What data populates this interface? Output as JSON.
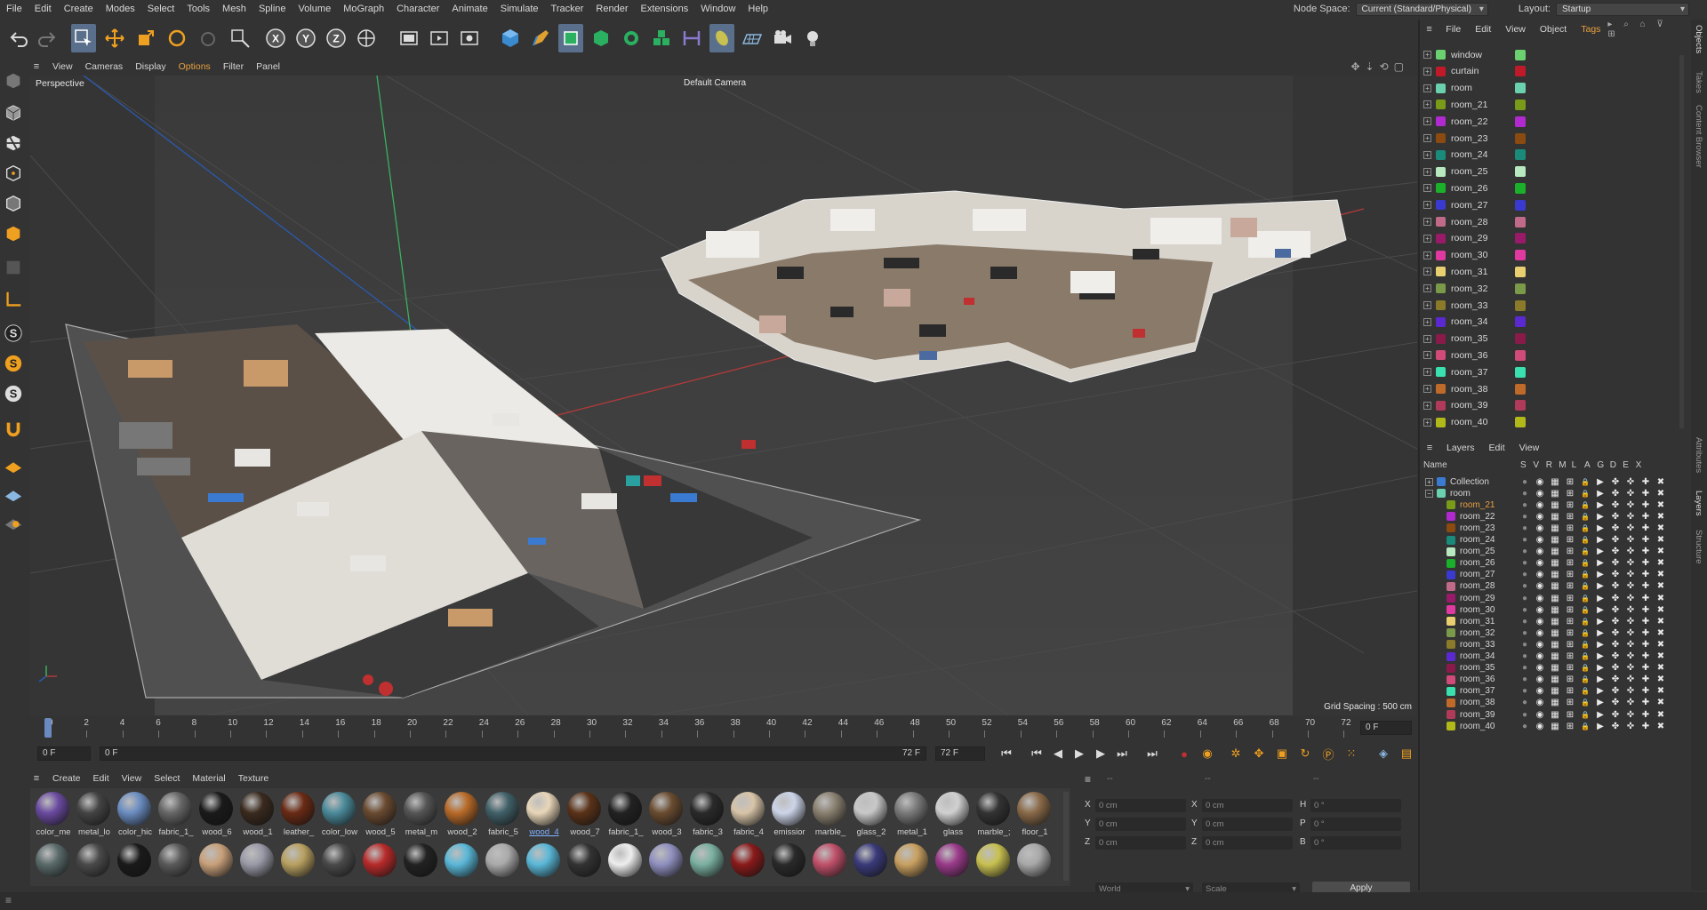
{
  "menu": {
    "items": [
      "File",
      "Edit",
      "Create",
      "Modes",
      "Select",
      "Tools",
      "Mesh",
      "Spline",
      "Volume",
      "MoGraph",
      "Character",
      "Animate",
      "Simulate",
      "Tracker",
      "Render",
      "Extensions",
      "Window",
      "Help"
    ],
    "node_space_label": "Node Space:",
    "node_space_value": "Current (Standard/Physical)",
    "layout_label": "Layout:",
    "layout_value": "Startup"
  },
  "viewport": {
    "menu": [
      "View",
      "Cameras",
      "Display",
      "Options",
      "Filter",
      "Panel"
    ],
    "view_name": "Perspective",
    "camera": "Default Camera",
    "grid_spacing": "Grid Spacing : 500 cm"
  },
  "timeline": {
    "ticks": [
      "0",
      "2",
      "4",
      "6",
      "8",
      "10",
      "12",
      "14",
      "16",
      "18",
      "20",
      "22",
      "24",
      "26",
      "28",
      "30",
      "32",
      "34",
      "36",
      "38",
      "40",
      "42",
      "44",
      "46",
      "48",
      "50",
      "52",
      "54",
      "56",
      "58",
      "60",
      "62",
      "64",
      "66",
      "68",
      "70",
      "72"
    ],
    "current_frame_right": "0 F",
    "start": "0 F",
    "preview_start": "0 F",
    "preview_end": "72 F",
    "end": "72 F"
  },
  "materials": {
    "menu": [
      "Create",
      "Edit",
      "View",
      "Select",
      "Material",
      "Texture"
    ],
    "row1": [
      "color_me",
      "metal_lo",
      "color_hic",
      "fabric_1_",
      "wood_6",
      "wood_1",
      "leather_",
      "color_low",
      "wood_5",
      "metal_m",
      "wood_2",
      "fabric_5",
      "wood_4",
      "wood_7",
      "fabric_1_",
      "wood_3",
      "fabric_3",
      "fabric_4",
      "emissior",
      "marble_",
      "glass_2",
      "metal_1",
      "glass",
      "marble_;",
      "floor_1"
    ],
    "selected": "wood_4",
    "colors_row1": [
      "#6a4aa0",
      "#444",
      "#6a8cc0",
      "#666",
      "#1a1a1a",
      "#3a2a1e",
      "#6a2a14",
      "#4a8a9a",
      "#6a4a30",
      "#555",
      "#b86a28",
      "#406068",
      "#e8d6b8",
      "#5a3218",
      "#222",
      "#6a4c30",
      "#2a2a2a",
      "#d8c4a8",
      "#ccd4e8",
      "#8a8070",
      "#c8c8c8",
      "#7a7a7a",
      "#d0d0d0",
      "#333",
      "#8a6a48"
    ],
    "colors_row2": [
      "#5a6a6a",
      "#4a4a4a",
      "#1a1a1a",
      "#5a5a5a",
      "#c8a07a",
      "#9a9aa8",
      "#b8a060",
      "#4a4a4a",
      "#b82a2a",
      "#222",
      "#5ab8d8",
      "#aaa",
      "#5ab8d8",
      "#333",
      "#eee",
      "#9090c0",
      "#7ab0a0",
      "#8a1a1a",
      "#2a2a2a",
      "#c0506a",
      "#3a3a7a",
      "#c8a060",
      "#9a3a8a",
      "#c8c050",
      "#a8a8a8"
    ]
  },
  "coords": {
    "col1_header": "--",
    "col2_header": "--",
    "col3_header": "--",
    "labels_pos": [
      "X",
      "Y",
      "Z"
    ],
    "labels_size": [
      "X",
      "Y",
      "Z"
    ],
    "labels_rot": [
      "H",
      "P",
      "B"
    ],
    "pos_values": [
      "0 cm",
      "0 cm",
      "0 cm"
    ],
    "size_values": [
      "0 cm",
      "0 cm",
      "0 cm"
    ],
    "rot_values": [
      "0 °",
      "0 °",
      "0 °"
    ],
    "mode1": "World",
    "mode2": "Scale",
    "apply": "Apply"
  },
  "objects": {
    "menu": [
      "File",
      "Edit",
      "View",
      "Object",
      "Tags"
    ],
    "rows": [
      {
        "name": "window",
        "icon": "#6ad070",
        "color": "#6ad070"
      },
      {
        "name": "curtain",
        "icon": "#c01a2a",
        "color": "#c01a2a"
      },
      {
        "name": "room",
        "icon": "#6ad0b0",
        "color": "#6ad0b0"
      },
      {
        "name": "room_21",
        "icon": "#7a9a1a",
        "color": "#7a9a1a"
      },
      {
        "name": "room_22",
        "icon": "#b02ad0",
        "color": "#b02ad0"
      },
      {
        "name": "room_23",
        "icon": "#8a4a10",
        "color": "#8a4a10"
      },
      {
        "name": "room_24",
        "icon": "#1a8a7a",
        "color": "#1a8a7a"
      },
      {
        "name": "room_25",
        "icon": "#b8e8c0",
        "color": "#b8e8c0"
      },
      {
        "name": "room_26",
        "icon": "#1ab02a",
        "color": "#1ab02a"
      },
      {
        "name": "room_27",
        "icon": "#3a3ad0",
        "color": "#3a3ad0"
      },
      {
        "name": "room_28",
        "icon": "#c06a8a",
        "color": "#c06a8a"
      },
      {
        "name": "room_29",
        "icon": "#9a1a6a",
        "color": "#9a1a6a"
      },
      {
        "name": "room_30",
        "icon": "#e03aa0",
        "color": "#e03aa0"
      },
      {
        "name": "room_31",
        "icon": "#e8d070",
        "color": "#e8d070"
      },
      {
        "name": "room_32",
        "icon": "#7a9a4a",
        "color": "#7a9a4a"
      },
      {
        "name": "room_33",
        "icon": "#8a7a2a",
        "color": "#8a7a2a"
      },
      {
        "name": "room_34",
        "icon": "#5a2ad0",
        "color": "#5a2ad0"
      },
      {
        "name": "room_35",
        "icon": "#8a1a4a",
        "color": "#8a1a4a"
      },
      {
        "name": "room_36",
        "icon": "#d04a7a",
        "color": "#d04a7a"
      },
      {
        "name": "room_37",
        "icon": "#3ae0b0",
        "color": "#3ae0b0"
      },
      {
        "name": "room_38",
        "icon": "#c06a2a",
        "color": "#c06a2a"
      },
      {
        "name": "room_39",
        "icon": "#b03a5a",
        "color": "#b03a5a"
      },
      {
        "name": "room_40",
        "icon": "#b0b81a",
        "color": "#b0b81a"
      }
    ]
  },
  "layers": {
    "menu": [
      "Layers",
      "Edit",
      "View"
    ],
    "header": {
      "name": "Name",
      "cols": [
        "S",
        "V",
        "R",
        "M",
        "L",
        "A",
        "G",
        "D",
        "E",
        "X"
      ]
    },
    "rows": [
      {
        "name": "Collection",
        "color": "#3a7ad0",
        "level": 0,
        "highlight": false
      },
      {
        "name": "room",
        "color": "#6ad0b0",
        "level": 0,
        "highlight": false
      },
      {
        "name": "room_21",
        "color": "#7a9a1a",
        "level": 1,
        "highlight": true
      },
      {
        "name": "room_22",
        "color": "#b02ad0",
        "level": 1,
        "highlight": false
      },
      {
        "name": "room_23",
        "color": "#8a4a10",
        "level": 1,
        "highlight": false
      },
      {
        "name": "room_24",
        "color": "#1a8a7a",
        "level": 1,
        "highlight": false
      },
      {
        "name": "room_25",
        "color": "#b8e8c0",
        "level": 1,
        "highlight": false
      },
      {
        "name": "room_26",
        "color": "#1ab02a",
        "level": 1,
        "highlight": false
      },
      {
        "name": "room_27",
        "color": "#3a3ad0",
        "level": 1,
        "highlight": false
      },
      {
        "name": "room_28",
        "color": "#c06a8a",
        "level": 1,
        "highlight": false
      },
      {
        "name": "room_29",
        "color": "#9a1a6a",
        "level": 1,
        "highlight": false
      },
      {
        "name": "room_30",
        "color": "#e03aa0",
        "level": 1,
        "highlight": false
      },
      {
        "name": "room_31",
        "color": "#e8d070",
        "level": 1,
        "highlight": false
      },
      {
        "name": "room_32",
        "color": "#7a9a4a",
        "level": 1,
        "highlight": false
      },
      {
        "name": "room_33",
        "color": "#8a7a2a",
        "level": 1,
        "highlight": false
      },
      {
        "name": "room_34",
        "color": "#5a2ad0",
        "level": 1,
        "highlight": false
      },
      {
        "name": "room_35",
        "color": "#8a1a4a",
        "level": 1,
        "highlight": false
      },
      {
        "name": "room_36",
        "color": "#d04a7a",
        "level": 1,
        "highlight": false
      },
      {
        "name": "room_37",
        "color": "#3ae0b0",
        "level": 1,
        "highlight": false
      },
      {
        "name": "room_38",
        "color": "#c06a2a",
        "level": 1,
        "highlight": false
      },
      {
        "name": "room_39",
        "color": "#b03a5a",
        "level": 1,
        "highlight": false
      },
      {
        "name": "room_40",
        "color": "#b0b81a",
        "level": 1,
        "highlight": false
      }
    ]
  },
  "sidetabs": [
    "Objects",
    "Takes",
    "Content Browser",
    "Attributes",
    "Layers",
    "Structure"
  ],
  "colors": {
    "accent": "#5a6f8c",
    "highlight_text": "#e8a040",
    "selected_mat": "#7fb0ff"
  }
}
